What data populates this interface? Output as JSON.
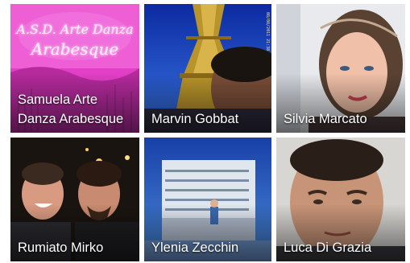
{
  "people": [
    {
      "name": "Samuela Arte Danza Arabesque"
    },
    {
      "name": "Marvin Gobbat"
    },
    {
      "name": "Silvia Marcato"
    },
    {
      "name": "Rumiato Mirko"
    },
    {
      "name": "Ylenia Zecchin"
    },
    {
      "name": "Luca Di Grazia"
    }
  ],
  "logo": {
    "line1": "A.S.D. Arte Danza",
    "line2": "Arabesque"
  },
  "photo_stamp": "08/08/2011 21:38",
  "colors": {
    "magenta": "#e040c8",
    "sky_blue": "#1f4fc0",
    "name_text": "#ffffff"
  }
}
